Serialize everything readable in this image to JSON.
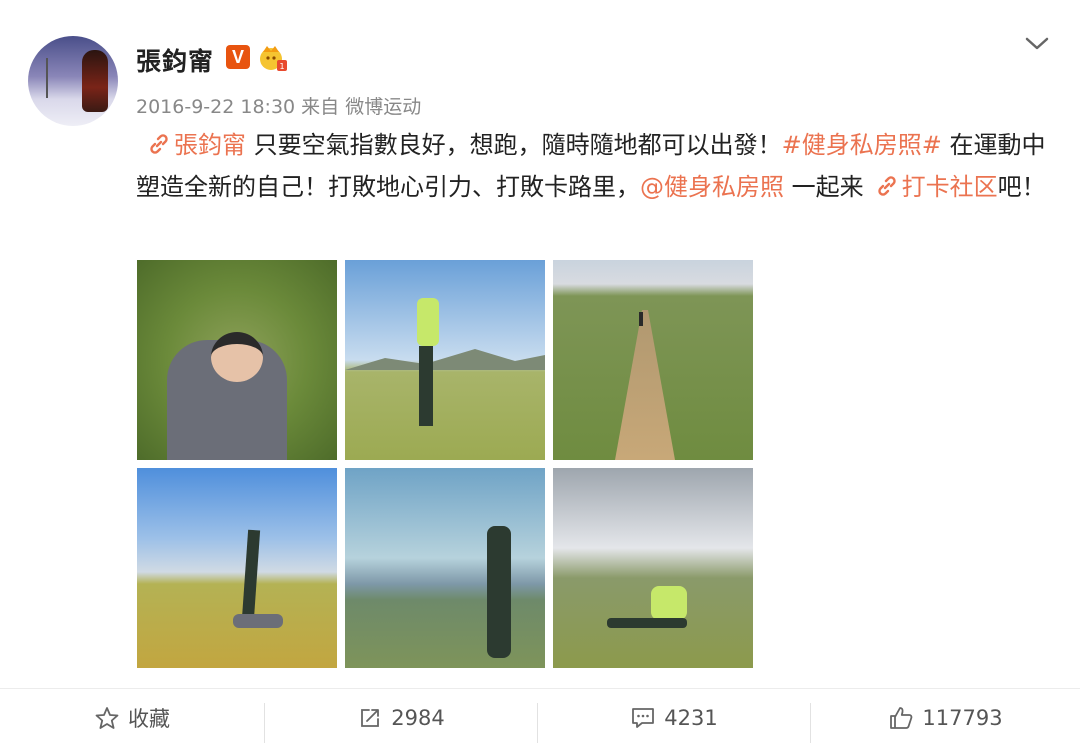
{
  "post": {
    "author": "張鈞甯",
    "meta": "2016-9-22 18:30 来自 微博运动",
    "verified_badge": "V",
    "content": {
      "link1": "張鈞甯",
      "text1": " 只要空氣指數良好，想跑，隨時隨地都可以出發！",
      "hashtag": "#健身私房照#",
      "text2": " 在運動中塑造全新的自己！打敗地心引力、打敗卡路里，",
      "mention": "@健身私房照",
      "text3": " 一起来",
      "link2": "打卡社区",
      "text4": "吧！"
    }
  },
  "actions": {
    "favorite": "收藏",
    "repost_count": "2984",
    "comment_count": "4231",
    "like_count": "117793"
  },
  "colors": {
    "link": "#eb7350",
    "badge": "#e8540f"
  },
  "icons": [
    "chevron-down-icon",
    "link-icon",
    "star-icon",
    "repost-icon",
    "comment-icon",
    "like-icon",
    "crown-icon"
  ]
}
